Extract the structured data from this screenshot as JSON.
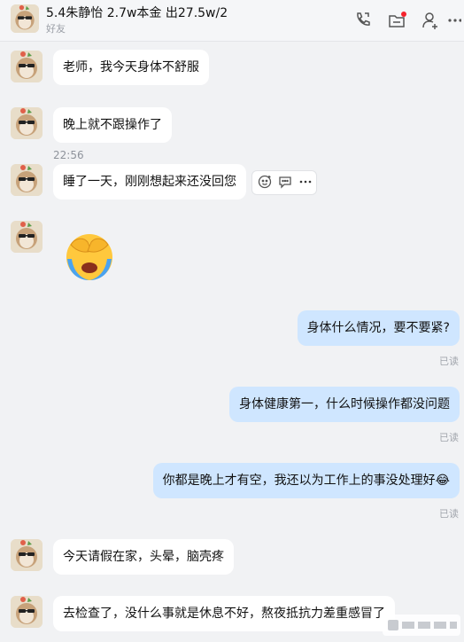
{
  "header": {
    "title": "5.4朱静怡 2.7w本金 出27.5w/2",
    "subtitle": "好友",
    "icons": [
      "phone-icon",
      "folder-icon",
      "add-user-icon",
      "more-icon"
    ]
  },
  "messages": [
    {
      "side": "left",
      "text": "老师，我今天身体不舒服"
    },
    {
      "side": "left",
      "text": "晚上就不跟操作了"
    },
    {
      "time": "22:56"
    },
    {
      "side": "left",
      "text": "睡了一天，刚刚想起来还没回您"
    },
    {
      "side": "left",
      "emoji": "face-covering-crying-emoji"
    },
    {
      "side": "right",
      "text": "身体什么情况，要不要紧?",
      "status": "已读"
    },
    {
      "side": "right",
      "text": "身体健康第一，什么时候操作都没问题",
      "status": "已读"
    },
    {
      "side": "right",
      "text": "你都是晚上才有空，我还以为工作上的事没处理好😂",
      "status": "已读"
    },
    {
      "side": "left",
      "text": "今天请假在家，头晕，脑壳疼"
    },
    {
      "side": "left",
      "text": "去检查了，没什么事就是休息不好，熬夜抵抗力差重感冒了"
    }
  ],
  "colors": {
    "right_bubble": "#cfe6ff",
    "left_bubble": "#ffffff",
    "background": "#f1f2f4",
    "notify_dot": "#f5222d"
  }
}
